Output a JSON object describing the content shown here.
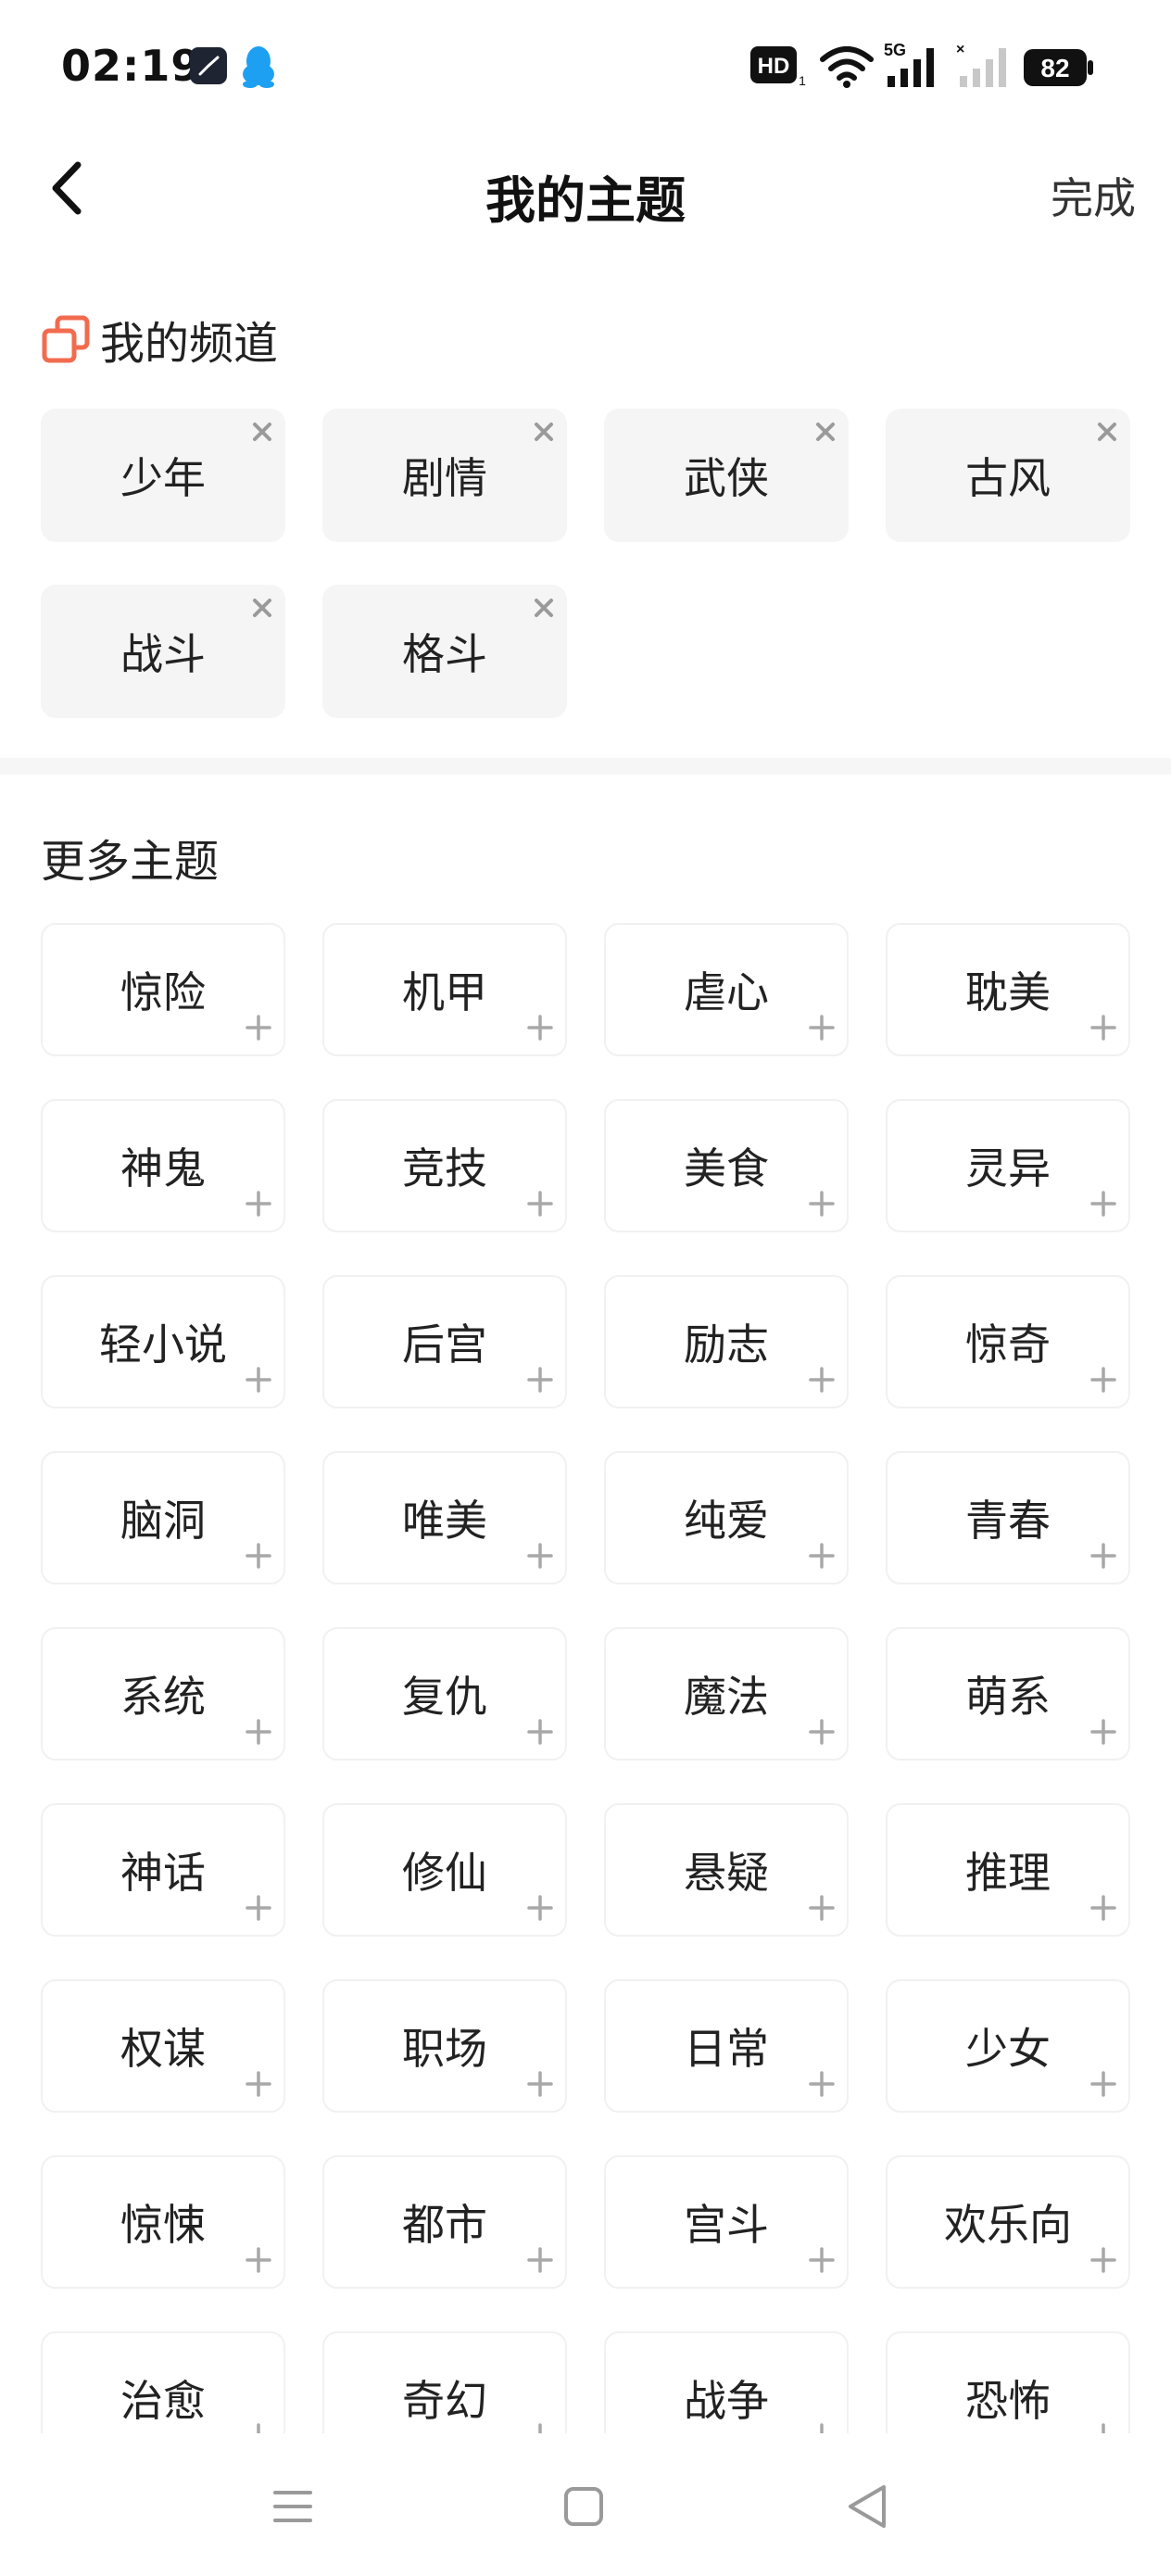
{
  "status_bar": {
    "time": "02:19",
    "battery": "82",
    "network": "5G",
    "hd_label": "HD"
  },
  "header": {
    "title": "我的主题",
    "done_label": "完成"
  },
  "my_channels": {
    "title": "我的频道",
    "items": [
      "少年",
      "剧情",
      "武侠",
      "古风",
      "战斗",
      "格斗"
    ]
  },
  "more_topics": {
    "title": "更多主题",
    "items": [
      "惊险",
      "机甲",
      "虐心",
      "耽美",
      "神鬼",
      "竞技",
      "美食",
      "灵异",
      "轻小说",
      "后宫",
      "励志",
      "惊奇",
      "脑洞",
      "唯美",
      "纯爱",
      "青春",
      "系统",
      "复仇",
      "魔法",
      "萌系",
      "神话",
      "修仙",
      "悬疑",
      "推理",
      "权谋",
      "职场",
      "日常",
      "少女",
      "惊悚",
      "都市",
      "宫斗",
      "欢乐向",
      "治愈",
      "奇幻",
      "战争",
      "恐怖"
    ]
  },
  "colors": {
    "accent": "#f26b4f",
    "tile_bg": "#f5f5f5",
    "divider": "#f6f6f6",
    "icon_gray": "#a8a8a8"
  },
  "icons": {
    "back": "chevron-left-icon",
    "channel": "channel-stack-icon",
    "remove": "close-icon",
    "add": "plus-icon",
    "nav_menu": "menu-icon",
    "nav_home": "home-square-icon",
    "nav_back": "back-triangle-icon"
  }
}
